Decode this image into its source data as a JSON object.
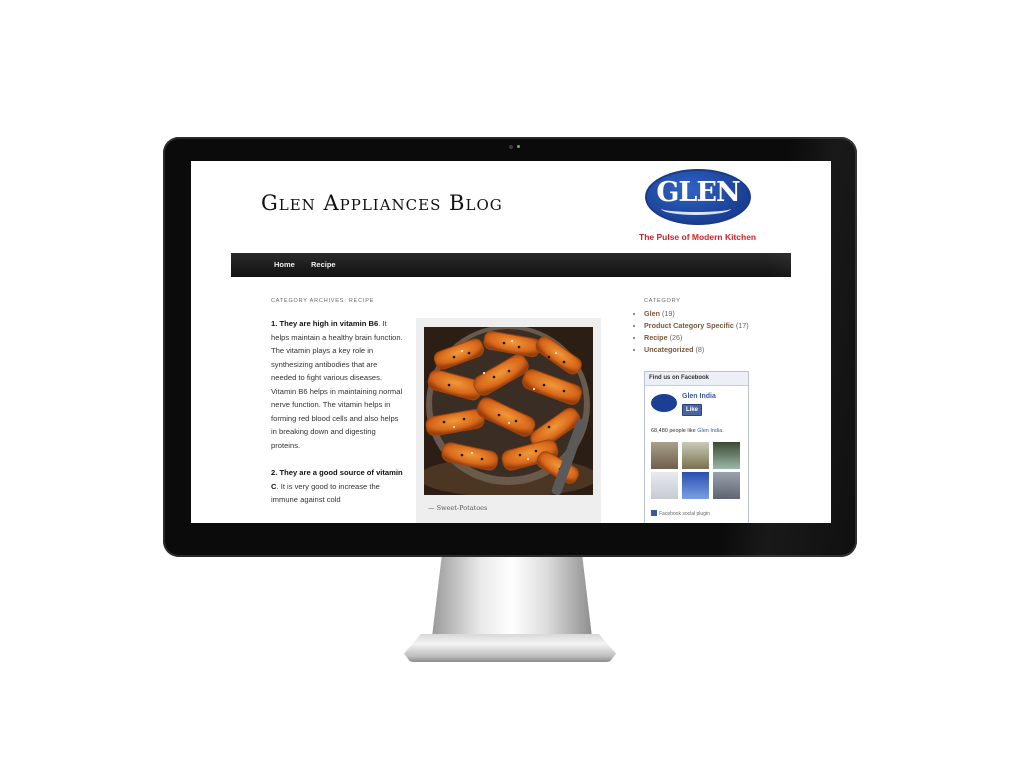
{
  "blog": {
    "title": "Glen Appliances Blog",
    "logo_text": "GLEN",
    "tagline": "The Pulse of Modern Kitchen"
  },
  "nav": {
    "items": [
      "Home",
      "Recipe"
    ]
  },
  "archive": {
    "label": "Category Archives: Recipe"
  },
  "post": {
    "p1_bold": "1.  They are high in vitamin B6",
    "p1_text": ". It helps maintain a healthy brain function. The vitamin plays a key role in synthesizing antibodies that are needed to fight various diseases. Vitamin B6 helps in maintaining normal nerve function. The vitamin helps in forming red blood cells and also helps in breaking down and digesting proteins.",
    "p2_bold": "2. They are a good source of vitamin C",
    "p2_text": ". It is very good to increase the immune against cold",
    "image_caption": "—     Sweet-Potatoes"
  },
  "sidebar": {
    "category_heading": "Category",
    "categories": [
      {
        "name": "Glen",
        "count": "(19)"
      },
      {
        "name": "Product Category Specific",
        "count": "(17)"
      },
      {
        "name": "Recipe",
        "count": "(26)"
      },
      {
        "name": "Uncategorized",
        "count": "(8)"
      }
    ]
  },
  "facebook": {
    "heading": "Find us on Facebook",
    "page_name": "Glen India",
    "like_label": "Like",
    "likes_text": "68,480 people like ",
    "likes_link": "Glen India.",
    "plugin_label": "Facebook social plugin"
  },
  "colors": {
    "nav_bg": "#1a1a1a",
    "brand_blue": "#1a3f93",
    "brand_red": "#d81f26",
    "facebook_blue": "#3b5998"
  }
}
